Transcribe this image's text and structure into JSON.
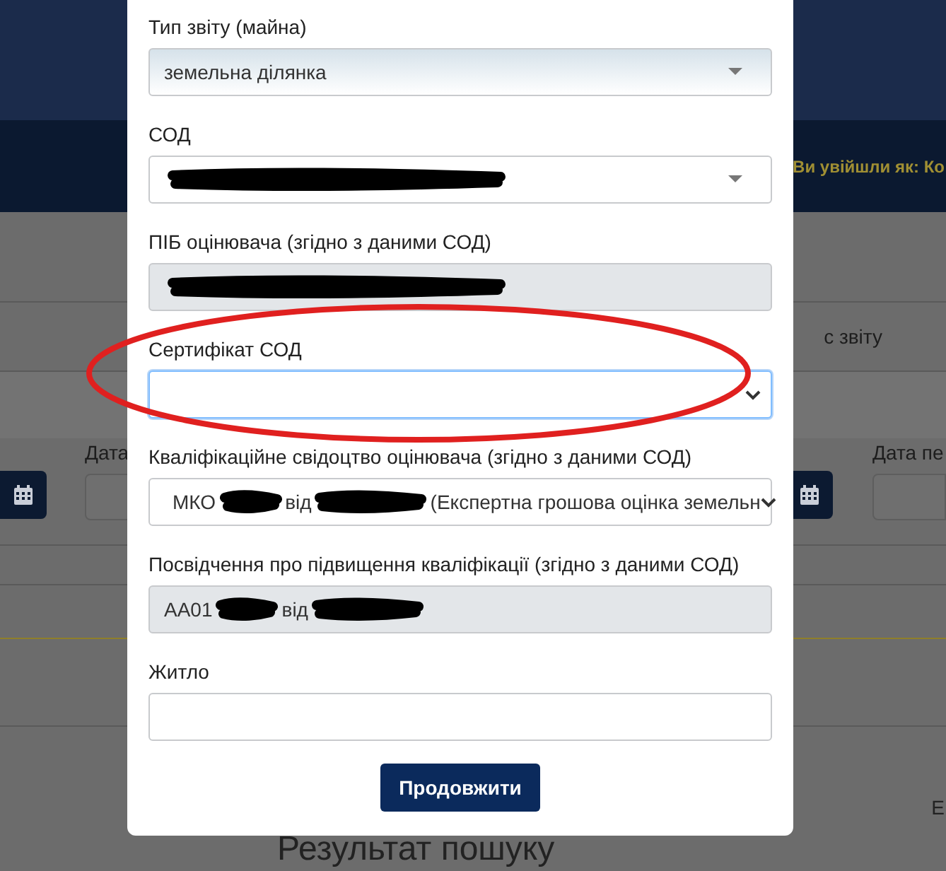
{
  "page": {
    "user_text": "Ви увійшли як: Ко",
    "report_label": "с звіту",
    "date_labels": [
      "Дата",
      "Дата пе"
    ],
    "results_heading": "Результат пошуку",
    "corner_text": "Е"
  },
  "dialog": {
    "fields": [
      {
        "kind": "dropdown",
        "label": "Тип звіту (майна)",
        "hovered": true,
        "focused": false,
        "highlighted": false,
        "value": [
          {
            "kind": "text",
            "text": "земельна ділянка"
          }
        ]
      },
      {
        "kind": "dropdown",
        "label": "СОД",
        "hovered": false,
        "focused": false,
        "highlighted": false,
        "value": [
          {
            "kind": "scribble"
          }
        ]
      },
      {
        "kind": "readonly",
        "label": "ПІБ оцінювача (згідно з даними СОД)",
        "hovered": false,
        "focused": false,
        "highlighted": false,
        "value": [
          {
            "kind": "scribble"
          }
        ]
      },
      {
        "kind": "select",
        "label": "Сертифікат СОД",
        "hovered": false,
        "focused": true,
        "highlighted": true
      },
      {
        "kind": "select",
        "label": "Кваліфікаційне свідоцтво оцінювача (згідно з даними СОД)",
        "hovered": false,
        "focused": false,
        "highlighted": false,
        "value": [
          {
            "kind": "text",
            "text": "МКО"
          },
          {
            "kind": "scribble"
          },
          {
            "kind": "text",
            "text": "від"
          },
          {
            "kind": "scribble"
          },
          {
            "kind": "text",
            "text": "(Експертна грошова оцінка земельн"
          }
        ]
      },
      {
        "kind": "readonly",
        "label": "Посвідчення про підвищення кваліфікації (згідно з даними СОД)",
        "hovered": false,
        "focused": false,
        "highlighted": false,
        "value": [
          {
            "kind": "text",
            "text": "АА01"
          },
          {
            "kind": "scribble"
          },
          {
            "kind": "text",
            "text": "від"
          },
          {
            "kind": "scribble"
          }
        ]
      },
      {
        "kind": "input",
        "label": "Житло",
        "hovered": false,
        "focused": false,
        "highlighted": false
      }
    ],
    "button": "Продовжити"
  }
}
